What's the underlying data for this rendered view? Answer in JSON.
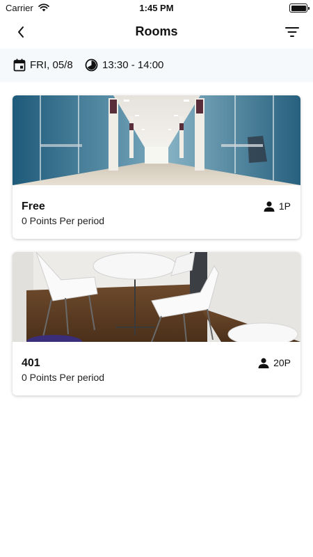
{
  "status_bar": {
    "carrier": "Carrier",
    "time": "1:45 PM"
  },
  "nav": {
    "title": "Rooms",
    "back_icon": "chevron-left-icon",
    "filter_icon": "filter-icon"
  },
  "booking": {
    "date": "FRI, 05/8",
    "time_range": "13:30 - 14:00"
  },
  "rooms": [
    {
      "name": "Free",
      "points": "0 Points Per period",
      "capacity": "1P",
      "image": "glass-corridor-photo"
    },
    {
      "name": "401",
      "points": "0 Points Per period",
      "capacity": "20P",
      "image": "meeting-room-photo"
    }
  ]
}
